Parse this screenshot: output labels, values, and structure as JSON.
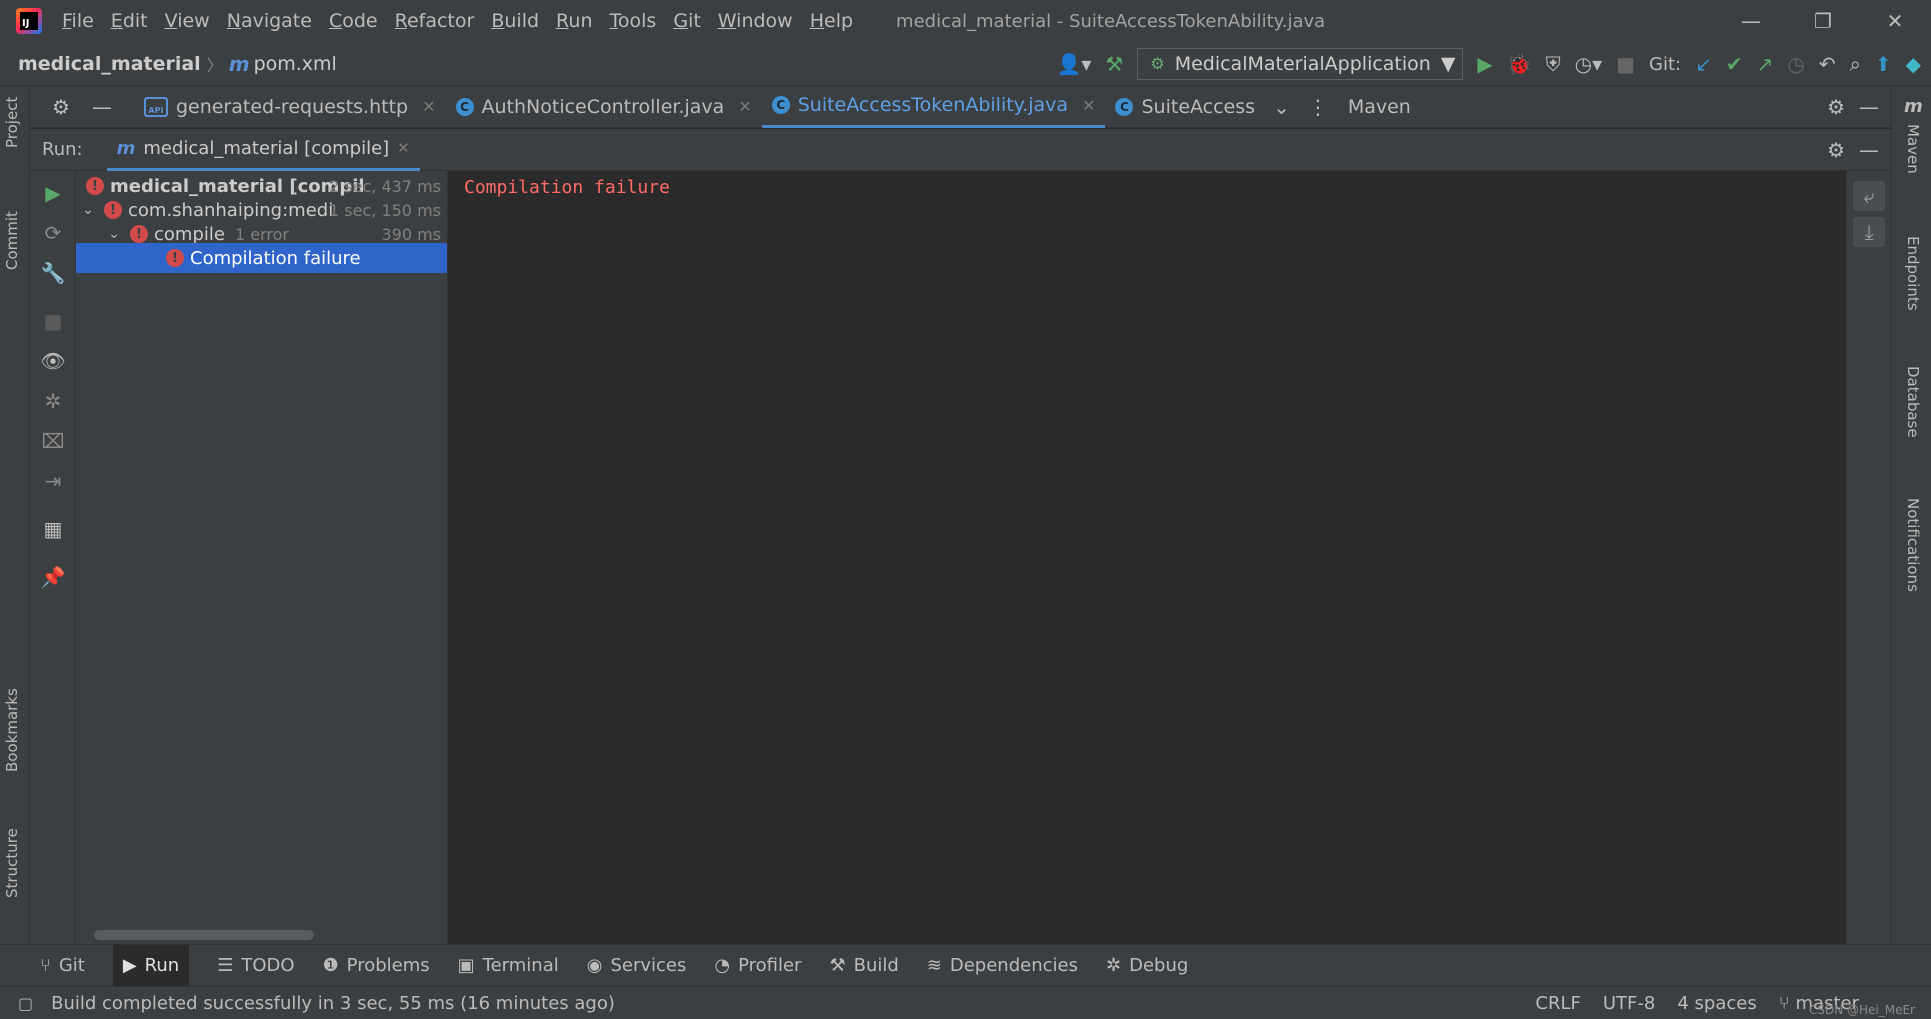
{
  "window": {
    "title": "medical_material - SuiteAccessTokenAbility.java",
    "menu": [
      "File",
      "Edit",
      "View",
      "Navigate",
      "Code",
      "Refactor",
      "Build",
      "Run",
      "Tools",
      "Git",
      "Window",
      "Help"
    ]
  },
  "navbar": {
    "project": "medical_material",
    "file": "pom.xml",
    "run_config": "MedicalMaterialApplication",
    "git_label": "Git:"
  },
  "editor_tabs": [
    {
      "label": "generated-requests.http",
      "icon": "api-icon",
      "active": false
    },
    {
      "label": "AuthNoticeController.java",
      "icon": "class-icon",
      "active": false
    },
    {
      "label": "SuiteAccessTokenAbility.java",
      "icon": "class-icon",
      "active": true
    },
    {
      "label": "SuiteAccess",
      "icon": "class-icon",
      "active": false
    }
  ],
  "maven_tab": "Maven",
  "left_stripe": {
    "project": "Project",
    "commit": "Commit",
    "bookmarks": "Bookmarks",
    "structure": "Structure"
  },
  "right_stripe": {
    "maven": "Maven",
    "endpoints": "Endpoints",
    "database": "Database",
    "notifications": "Notifications"
  },
  "run": {
    "label": "Run:",
    "tab": "medical_material [compile]",
    "tree": [
      {
        "text": "medical_material [compil",
        "time": "2 sec, 437 ms",
        "bold": true
      },
      {
        "text": "com.shanhaiping:medi",
        "time": "1 sec, 150 ms"
      },
      {
        "text": "compile",
        "extra": "1 error",
        "time": "390 ms"
      },
      {
        "text": "Compilation failure",
        "selected": true
      }
    ],
    "console": "Compilation failure"
  },
  "tool_tabs": [
    "Git",
    "Run",
    "TODO",
    "Problems",
    "Terminal",
    "Services",
    "Profiler",
    "Build",
    "Dependencies",
    "Debug"
  ],
  "status": {
    "message": "Build completed successfully in 3 sec, 55 ms (16 minutes ago)",
    "line_sep": "CRLF",
    "encoding": "UTF-8",
    "indent": "4 spaces",
    "branch": "master"
  },
  "watermark": "CSDN @Hei_MeEr",
  "colors": {
    "accent": "#4a88c7",
    "error": "#d34a4a",
    "console_error": "#ff6b68",
    "selection": "#2f65ca"
  }
}
